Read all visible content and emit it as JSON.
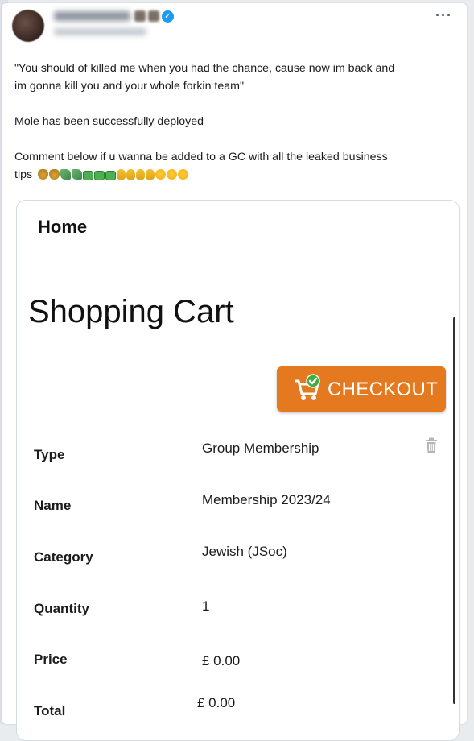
{
  "tweet": {
    "lines": [
      "\"You should of killed me when you had the chance, cause now im back and",
      "im gonna kill you and your whole forkin team\"",
      "Mole has been successfully deployed",
      "Comment below if u wanna be added to a GC with all the leaked business",
      "tips"
    ],
    "more_icon": "more-horizontal-icon",
    "verified_icon": "verified-badge-icon"
  },
  "cart_screen": {
    "home": "Home",
    "title": "Shopping Cart",
    "checkout_label": "CHECKOUT",
    "checkout_color": "#e5791f",
    "rows": [
      {
        "label": "Type",
        "value": "Group Membership"
      },
      {
        "label": "Name",
        "value": "Membership 2023/24"
      },
      {
        "label": "Category",
        "value": "Jewish (JSoc)"
      },
      {
        "label": "Quantity",
        "value": "1"
      },
      {
        "label": "Price",
        "value": "£ 0.00"
      },
      {
        "label": "Total",
        "value": "£ 0.00"
      }
    ]
  }
}
